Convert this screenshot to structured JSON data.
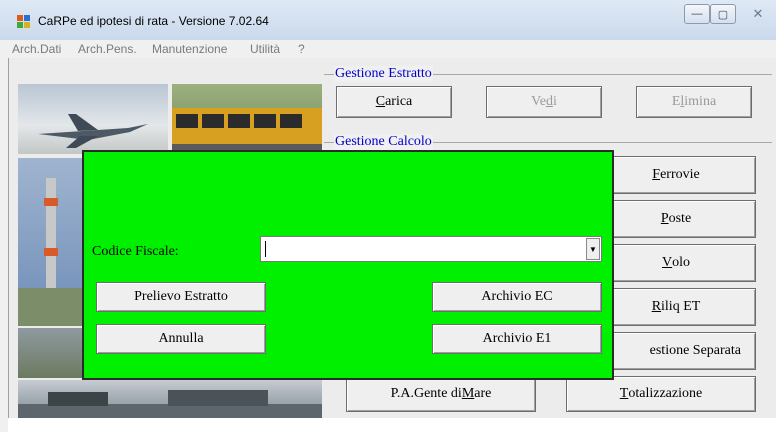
{
  "window": {
    "title": "CaRPe ed ipotesi di rata  -  Versione 7.02.64",
    "controls": {
      "minimize": "—",
      "maximize": "▢",
      "close": "✕"
    }
  },
  "menu": [
    "Arch.Dati",
    "Arch.Pens.",
    "Manutenzione",
    "Utilità",
    "?"
  ],
  "gestione_estratto": {
    "label": "Gestione Estratto",
    "buttons": [
      {
        "text_pre": "",
        "text_ul": "C",
        "text_post": "arica",
        "enabled": true
      },
      {
        "text_pre": "Ve",
        "text_ul": "d",
        "text_post": "i",
        "enabled": false
      },
      {
        "text_pre": "E",
        "text_ul": "l",
        "text_post": "imina",
        "enabled": false
      }
    ]
  },
  "gestione_calcolo": {
    "label": "Gestione Calcolo",
    "right_buttons": [
      {
        "text_pre": "",
        "text_ul": "F",
        "text_post": "errovie"
      },
      {
        "text_pre": "",
        "text_ul": "P",
        "text_post": "oste"
      },
      {
        "text_pre": "",
        "text_ul": "V",
        "text_post": "olo"
      },
      {
        "text_pre": "",
        "text_ul": "R",
        "text_post": "iliq ET"
      },
      {
        "text_pre": "",
        "text_ul": "",
        "text_post": "estione Separata"
      }
    ],
    "bottom_buttons": [
      {
        "text_pre": "P.A.Gente di ",
        "text_ul": "M",
        "text_post": "are"
      },
      {
        "text_pre": "",
        "text_ul": "T",
        "text_post": "otalizzazione"
      }
    ]
  },
  "dialog": {
    "background": "#00f000",
    "codice_fiscale_label": "Codice Fiscale:",
    "codice_fiscale_value": "",
    "buttons": {
      "prelievo": "Prelievo Estratto",
      "annulla": "Annulla",
      "archivio_ec": "Archivio EC",
      "archivio_e1": "Archivio E1"
    }
  },
  "icons": {
    "app": "carpe-app-icon",
    "combo_arrow": "chevron-down-icon"
  }
}
